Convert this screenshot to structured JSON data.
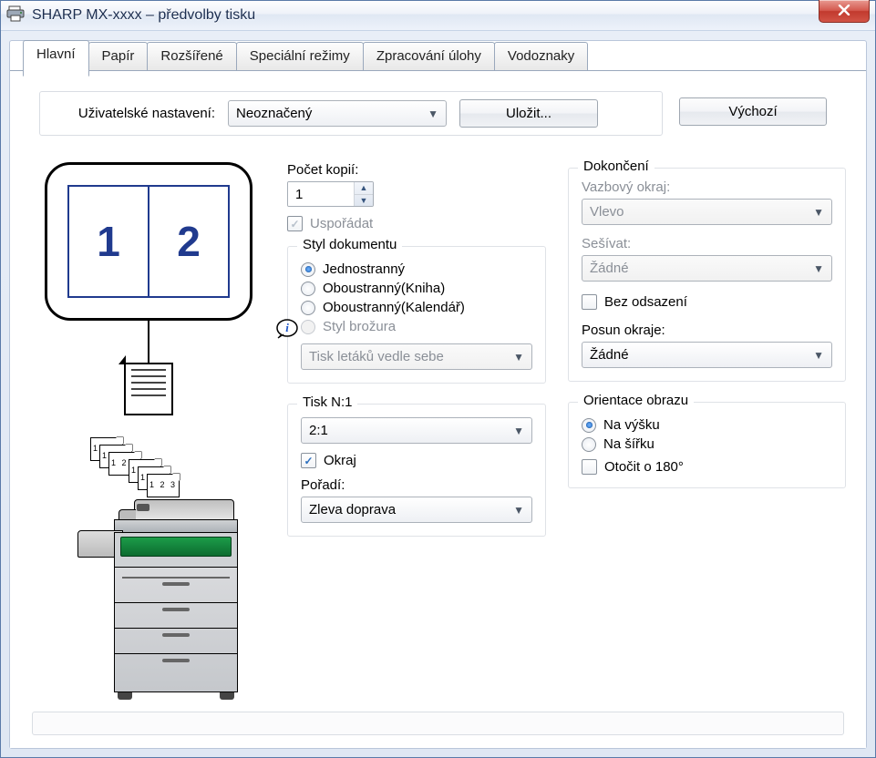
{
  "window": {
    "title": "SHARP MX-xxxx – předvolby tisku"
  },
  "tabs": {
    "main": "Hlavní",
    "paper": "Papír",
    "advanced": "Rozšířené",
    "special": "Speciální režimy",
    "job": "Zpracování úlohy",
    "water": "Vodoznaky"
  },
  "settings": {
    "label": "Uživatelské nastavení:",
    "value": "Neoznačený",
    "save": "Uložit...",
    "default": "Výchozí"
  },
  "preview": {
    "page1": "1",
    "page2": "2"
  },
  "copies": {
    "label": "Počet kopií:",
    "value": "1",
    "collate": "Uspořádat"
  },
  "docstyle": {
    "legend": "Styl dokumentu",
    "r1": "Jednostranný",
    "r2": "Oboustranný(Kniha)",
    "r3": "Oboustranný(Kalendář)",
    "r4": "Styl brožura",
    "combo": "Tisk letáků vedle sebe"
  },
  "nup": {
    "legend": "Tisk N:1",
    "value": "2:1",
    "border": "Okraj",
    "order_label": "Pořadí:",
    "order_value": "Zleva doprava"
  },
  "finish": {
    "legend": "Dokončení",
    "bind_label": "Vazbový okraj:",
    "bind_value": "Vlevo",
    "staple_label": "Sešívat:",
    "staple_value": "Žádné",
    "nooffset": "Bez odsazení",
    "margin_label": "Posun okraje:",
    "margin_value": "Žádné"
  },
  "orient": {
    "legend": "Orientace obrazu",
    "portrait": "Na výšku",
    "landscape": "Na šířku",
    "rotate": "Otočit o 180°"
  }
}
